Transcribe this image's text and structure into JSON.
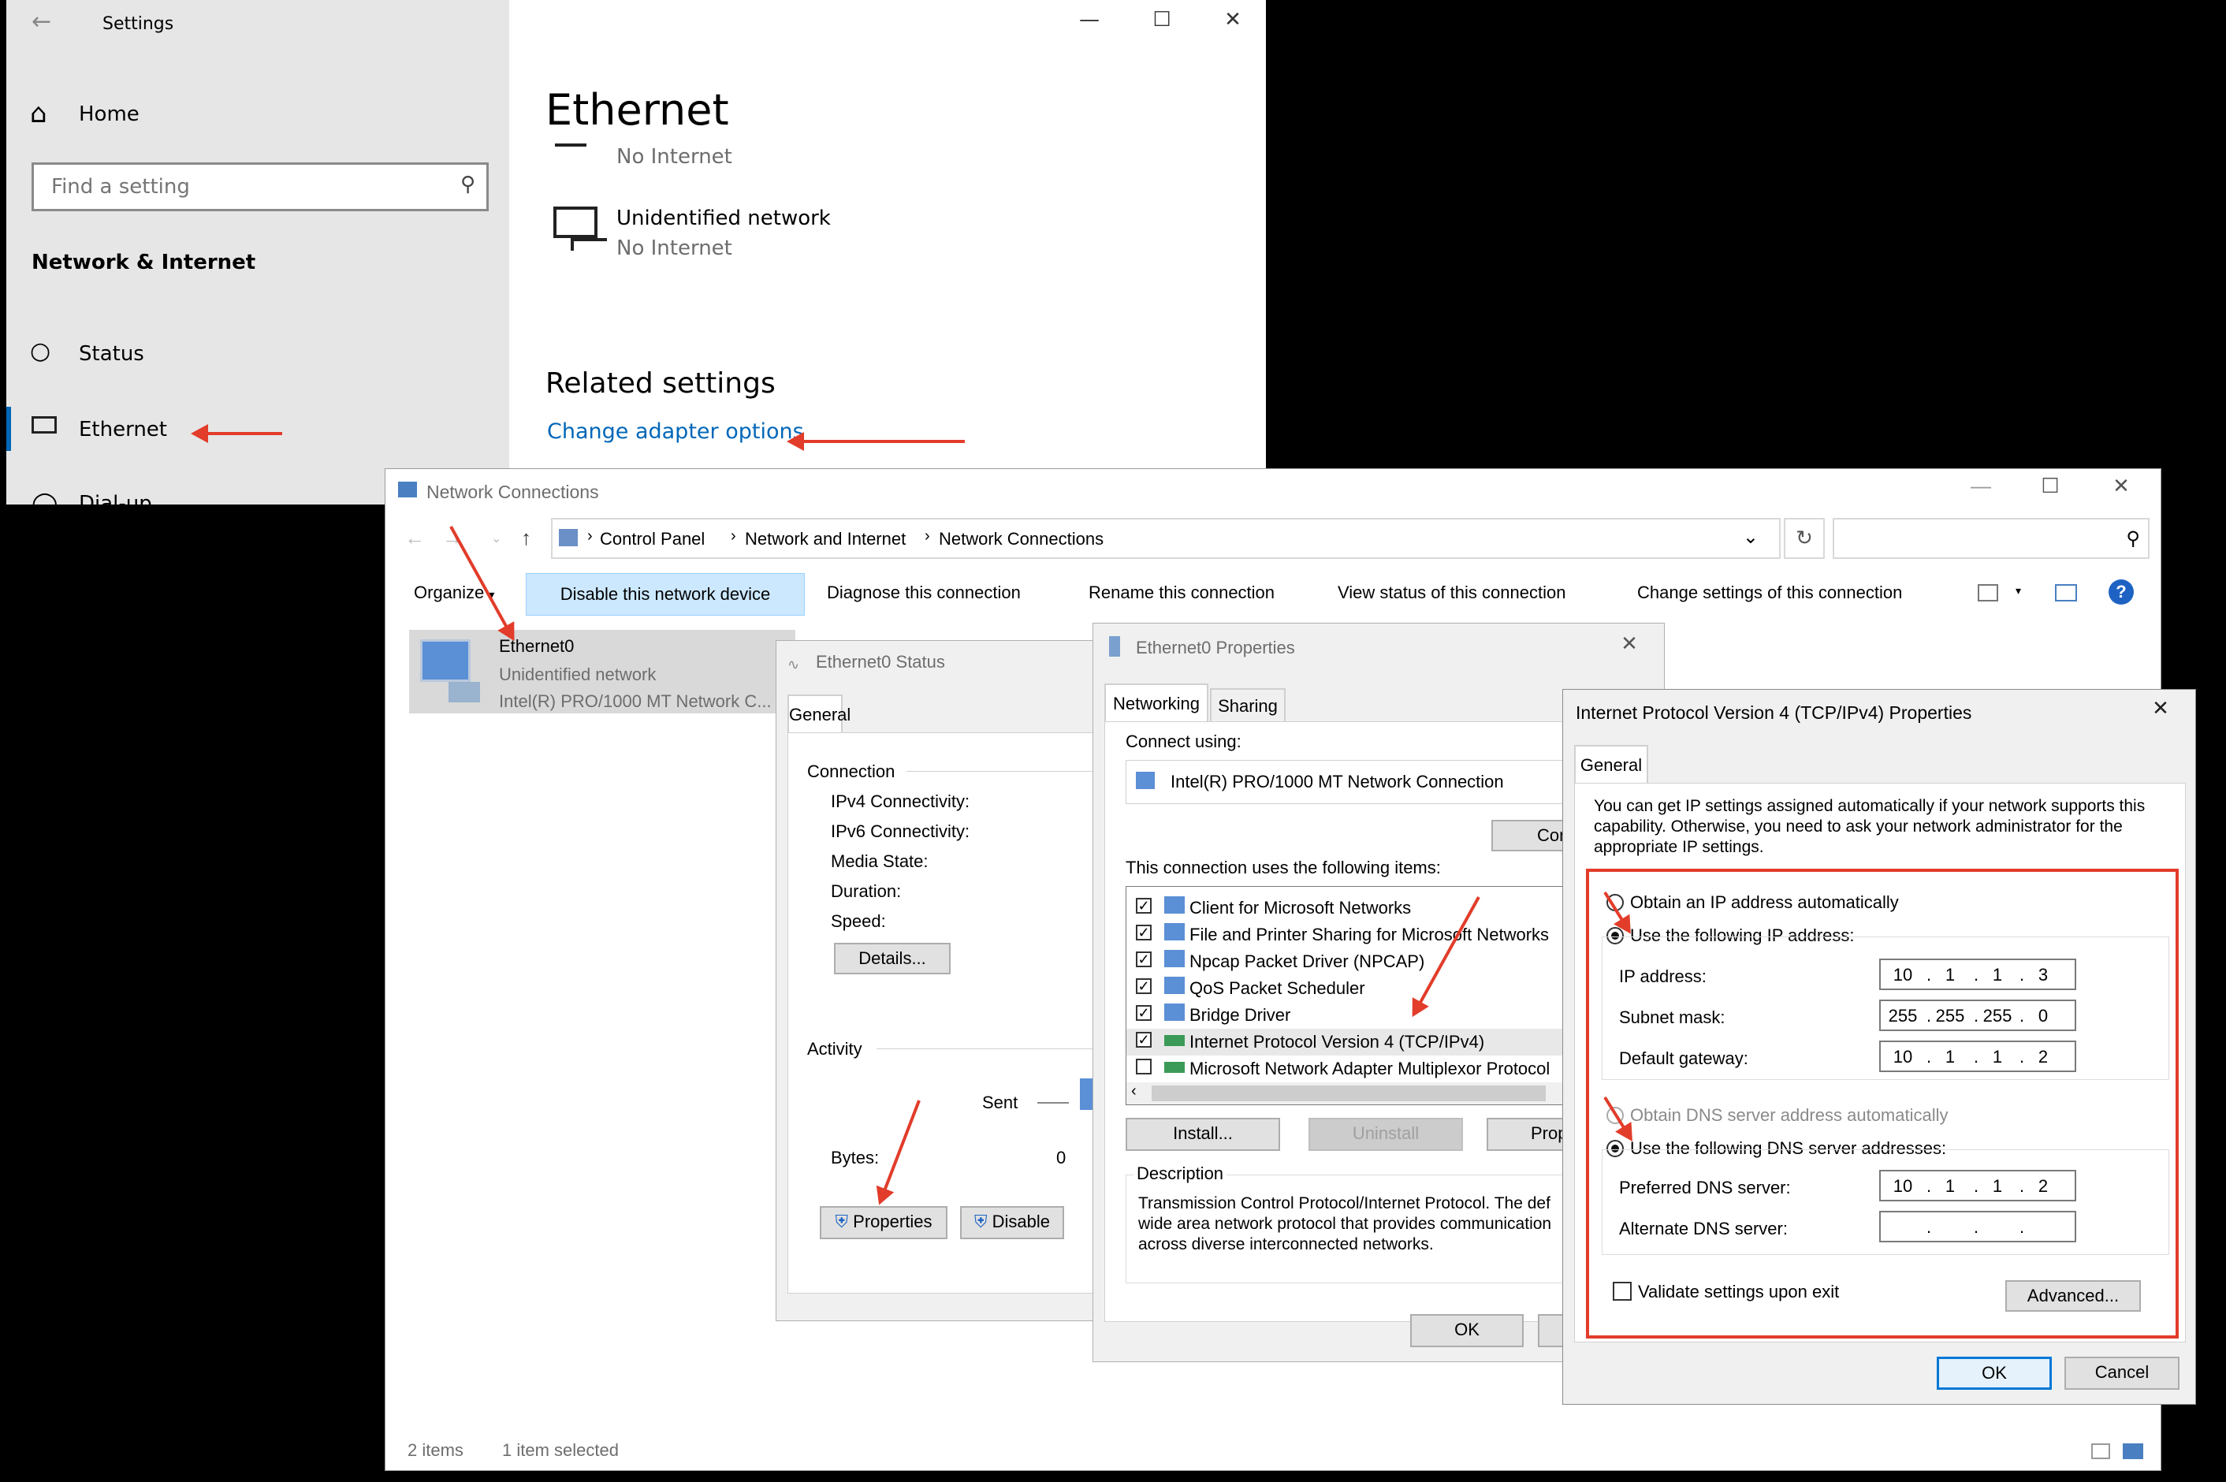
{
  "settings": {
    "title": "Settings",
    "home": "Home",
    "search_placeholder": "Find a setting",
    "section": "Network & Internet",
    "nav": [
      {
        "label": "Status"
      },
      {
        "label": "Ethernet"
      },
      {
        "label": "Dial-up"
      }
    ],
    "page_title": "Ethernet",
    "net1_status": "No Internet",
    "net2_name": "Unidentified network",
    "net2_status": "No Internet",
    "related": "Related settings",
    "change_adapter": "Change adapter options"
  },
  "netconn": {
    "title": "Network Connections",
    "breadcrumb": [
      "Control Panel",
      "Network and Internet",
      "Network Connections"
    ],
    "toolbar": [
      "Organize",
      "Disable this network device",
      "Diagnose this connection",
      "Rename this connection",
      "View status of this connection",
      "Change settings of this connection"
    ],
    "adapter": {
      "name": "Ethernet0",
      "status": "Unidentified network",
      "device": "Intel(R) PRO/1000 MT Network C..."
    },
    "status_items": "2 items",
    "status_selected": "1 item selected"
  },
  "status_dialog": {
    "title": "Ethernet0 Status",
    "tab": "General",
    "connection": "Connection",
    "rows": [
      "IPv4 Connectivity:",
      "IPv6 Connectivity:",
      "Media State:",
      "Duration:",
      "Speed:"
    ],
    "details": "Details...",
    "activity": "Activity",
    "sent": "Sent",
    "bytes": "Bytes:",
    "bytes_val": "0",
    "properties": "Properties",
    "disable": "Disable"
  },
  "props_dialog": {
    "title": "Ethernet0 Properties",
    "tabs": [
      "Networking",
      "Sharing"
    ],
    "connect_using": "Connect using:",
    "adapter": "Intel(R) PRO/1000 MT Network Connection",
    "configure": "Config",
    "items_label": "This connection uses the following items:",
    "items": [
      {
        "label": "Client for Microsoft Networks",
        "checked": true
      },
      {
        "label": "File and Printer Sharing for Microsoft Networks",
        "checked": true
      },
      {
        "label": "Npcap Packet Driver (NPCAP)",
        "checked": true
      },
      {
        "label": "QoS Packet Scheduler",
        "checked": true
      },
      {
        "label": "Bridge Driver",
        "checked": true
      },
      {
        "label": "Internet Protocol Version 4 (TCP/IPv4)",
        "checked": true
      },
      {
        "label": "Microsoft Network Adapter Multiplexor Protocol",
        "checked": false
      }
    ],
    "install": "Install...",
    "uninstall": "Uninstall",
    "properties": "Proper",
    "description_label": "Description",
    "description": "Transmission Control Protocol/Internet Protocol. The def wide area network protocol that provides communication across diverse interconnected networks.",
    "ok": "OK"
  },
  "ipv4_dialog": {
    "title": "Internet Protocol Version 4 (TCP/IPv4) Properties",
    "tab": "General",
    "intro": "You can get IP settings assigned automatically if your network supports this capability. Otherwise, you need to ask your network administrator for the appropriate IP settings.",
    "obtain_ip": "Obtain an IP address automatically",
    "use_ip": "Use the following IP address:",
    "ip_label": "IP address:",
    "ip": [
      "10",
      "1",
      "1",
      "3"
    ],
    "mask_label": "Subnet mask:",
    "mask": [
      "255",
      "255",
      "255",
      "0"
    ],
    "gw_label": "Default gateway:",
    "gw": [
      "10",
      "1",
      "1",
      "2"
    ],
    "obtain_dns": "Obtain DNS server address automatically",
    "use_dns": "Use the following DNS server addresses:",
    "pref_label": "Preferred DNS server:",
    "pref": [
      "10",
      "1",
      "1",
      "2"
    ],
    "alt_label": "Alternate DNS server:",
    "validate": "Validate settings upon exit",
    "advanced": "Advanced...",
    "ok": "OK",
    "cancel": "Cancel"
  },
  "colors": {
    "accent": "#0067b8",
    "highlight": "#e23c2a"
  }
}
